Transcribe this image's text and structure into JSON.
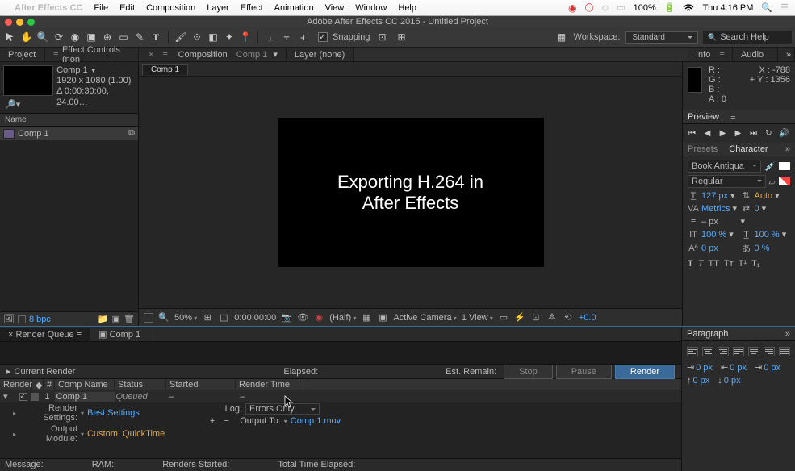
{
  "menubar": {
    "app": "After Effects CC",
    "items": [
      "File",
      "Edit",
      "Composition",
      "Layer",
      "Effect",
      "Animation",
      "View",
      "Window",
      "Help"
    ],
    "battery": "100%",
    "time": "Thu 4:16 PM"
  },
  "window_title": "Adobe After Effects CC 2015 - Untitled Project",
  "toolbar": {
    "snapping": "Snapping",
    "workspace_label": "Workspace:",
    "workspace_value": "Standard",
    "search_placeholder": "Search Help"
  },
  "top_panels": {
    "project": "Project",
    "effect_controls": "Effect Controls (non",
    "composition_prefix": "Composition",
    "composition_name": "Comp 1",
    "layer": "Layer (none)"
  },
  "project": {
    "comp_name": "Comp 1",
    "dims": "1920 x 1080 (1.00)",
    "dur": "Δ 0:00:30:00, 24.00…",
    "col_name": "Name",
    "item": "Comp 1",
    "bpc": "8 bpc"
  },
  "comp_tab": "Comp 1",
  "canvas": {
    "line1": "Exporting H.264 in",
    "line2": "After Effects"
  },
  "viewer": {
    "zoom": "50%",
    "time": "0:00:00:00",
    "res": "(Half)",
    "camera": "Active Camera",
    "views": "1 View",
    "exposure": "+0.0"
  },
  "info": {
    "tab_info": "Info",
    "tab_audio": "Audio",
    "R": "R :",
    "G": "G :",
    "B": "B :",
    "A": "A : 0",
    "X": "X : -788",
    "Y": "Y : 1356",
    "plus": "+"
  },
  "preview": {
    "tab": "Preview"
  },
  "character": {
    "presets": "Presets",
    "tab": "Character",
    "font": "Book Antiqua",
    "style": "Regular",
    "size": "127 px",
    "leading": "Auto",
    "kerning": "Metrics",
    "tracking": "0",
    "dash": "– px",
    "scaleV": "100 %",
    "scaleH": "100 %",
    "baseline": "0 px",
    "tsume": "0 %"
  },
  "paragraph": {
    "tab": "Paragraph",
    "vals": [
      "0 px",
      "0 px",
      "0 px",
      "0 px",
      "0 px"
    ]
  },
  "rq": {
    "tab_rq": "Render Queue",
    "tab_comp": "Comp 1",
    "current": "Current Render",
    "elapsed": "Elapsed:",
    "remain": "Est. Remain:",
    "btn_stop": "Stop",
    "btn_pause": "Pause",
    "btn_render": "Render",
    "h_render": "Render",
    "h_num": "#",
    "h_comp": "Comp Name",
    "h_status": "Status",
    "h_started": "Started",
    "h_rtime": "Render Time",
    "row_num": "1",
    "row_comp": "Comp 1",
    "row_status": "Queued",
    "row_started": "–",
    "row_rtime": "–",
    "rs_label": "Render Settings:",
    "rs_value": "Best Settings",
    "om_label": "Output Module:",
    "om_value": "Custom: QuickTime",
    "log_label": "Log:",
    "log_value": "Errors Only",
    "out_label": "Output To:",
    "out_value": "Comp 1.mov",
    "f_msg": "Message:",
    "f_ram": "RAM:",
    "f_rs": "Renders Started:",
    "f_tte": "Total Time Elapsed:"
  }
}
